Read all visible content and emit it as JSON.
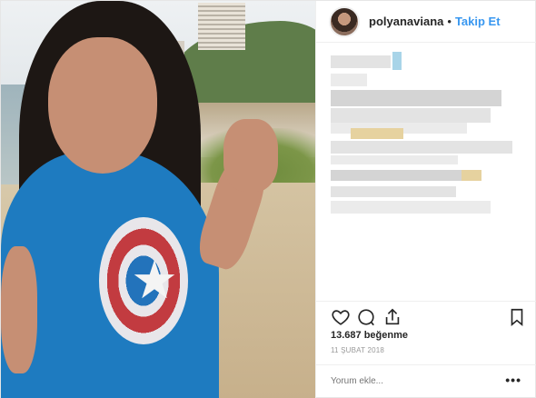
{
  "header": {
    "username": "polyanaviana",
    "separator": "•",
    "follow_label": "Takip Et"
  },
  "actions": {
    "like_icon": "heart-icon",
    "comment_icon": "comment-icon",
    "share_icon": "share-icon",
    "save_icon": "bookmark-icon"
  },
  "stats": {
    "likes": "13.687 beğenme",
    "date": "11 ŞUBAT 2018"
  },
  "comment": {
    "placeholder": "Yorum ekle...",
    "more_label": "•••"
  },
  "colors": {
    "link": "#3897f0",
    "text": "#262626",
    "muted": "#999999"
  }
}
